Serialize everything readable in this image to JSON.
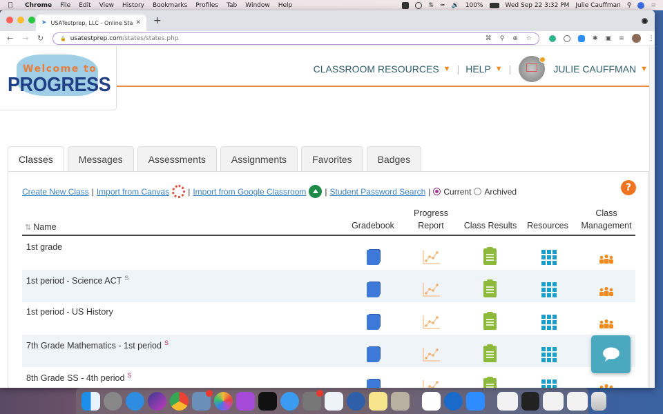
{
  "menubar": {
    "app": "Chrome",
    "items": [
      "File",
      "Edit",
      "View",
      "History",
      "Bookmarks",
      "Profiles",
      "Tab",
      "Window",
      "Help"
    ],
    "battery": "100%",
    "datetime": "Wed Sep 22  3:32 PM",
    "user": "Julie Cauffman"
  },
  "browser": {
    "tab_title": "USATestprep, LLC - Online Sta",
    "url_domain": "usatestprep.com",
    "url_path": "/states/states.php"
  },
  "header": {
    "logo_top": "Welcome to",
    "logo_main": "PROGRESS",
    "nav": {
      "classroom_resources": "CLASSROOM RESOURCES",
      "help": "HELP",
      "user": "JULIE CAUFFMAN"
    },
    "colors": {
      "accent": "#f08418",
      "nav_text": "#2f5b6a"
    }
  },
  "tabs": [
    {
      "label": "Classes",
      "active": true
    },
    {
      "label": "Messages",
      "active": false
    },
    {
      "label": "Assessments",
      "active": false
    },
    {
      "label": "Assignments",
      "active": false
    },
    {
      "label": "Favorites",
      "active": false
    },
    {
      "label": "Badges",
      "active": false
    }
  ],
  "actions": {
    "create": "Create New Class",
    "import_canvas": "Import from Canvas",
    "import_google": "Import from Google Classroom",
    "password_search": "Student Password Search",
    "current": "Current",
    "archived": "Archived",
    "filter_selected": "Current",
    "help_glyph": "?"
  },
  "table": {
    "columns": {
      "name": "Name",
      "gradebook": "Gradebook",
      "progress_1": "Progress",
      "progress_2": "Report",
      "class_results": "Class Results",
      "resources": "Resources",
      "class_mgmt_1": "Class",
      "class_mgmt_2": "Management"
    },
    "rows": [
      {
        "name": "1st grade",
        "marker": ""
      },
      {
        "name": "1st period - Science ACT",
        "marker": "S"
      },
      {
        "name": "1st period - US History",
        "marker": ""
      },
      {
        "name": "7th Grade Mathematics - 1st period",
        "marker": "S"
      },
      {
        "name": "8th Grade SS - 4th period",
        "marker": "S"
      }
    ]
  }
}
